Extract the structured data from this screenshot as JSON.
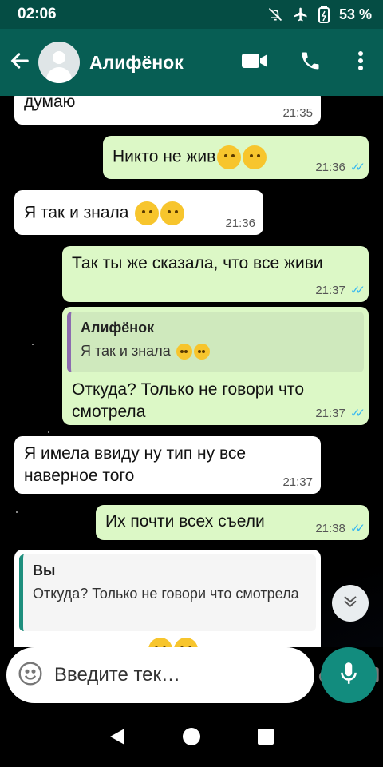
{
  "status": {
    "time": "02:06",
    "battery": "53 %"
  },
  "header": {
    "contact_name": "Алифёнок"
  },
  "messages": [
    {
      "dir": "in",
      "text": "думаю",
      "time": "21:35"
    },
    {
      "dir": "out",
      "text": "Никто не жив",
      "time": "21:36"
    },
    {
      "dir": "in",
      "text": "Я так и знала",
      "time": "21:36"
    },
    {
      "dir": "out",
      "text": "Так ты же сказала, что все живи",
      "time": "21:37"
    },
    {
      "dir": "out",
      "reply_name": "Алифёнок",
      "reply_text": "Я так и знала",
      "text": "Откуда? Только не говори что смотрела",
      "time": "21:37"
    },
    {
      "dir": "in",
      "text": "Я имела ввиду ну тип ну все наверное того",
      "time": "21:37"
    },
    {
      "dir": "out",
      "text": "Их почти всех съели",
      "time": "21:38"
    },
    {
      "dir": "in",
      "reply_name": "Вы",
      "reply_text": "Откуда? Только не говори что смотрела"
    }
  ],
  "composer": {
    "placeholder": "Введите тек…"
  },
  "colors": {
    "header": "#075e54",
    "status": "#054d44",
    "outgoing": "#dcf8c6",
    "incoming": "#ffffff",
    "accent": "#128c7e",
    "ticks": "#34b7f1"
  },
  "icons": [
    "back-arrow-icon",
    "video-call-icon",
    "phone-icon",
    "more-vert-icon",
    "emoji-icon",
    "attach-icon",
    "camera-icon",
    "mic-icon",
    "chevron-down-icon",
    "nav-back-icon",
    "nav-home-icon",
    "nav-recents-icon"
  ]
}
